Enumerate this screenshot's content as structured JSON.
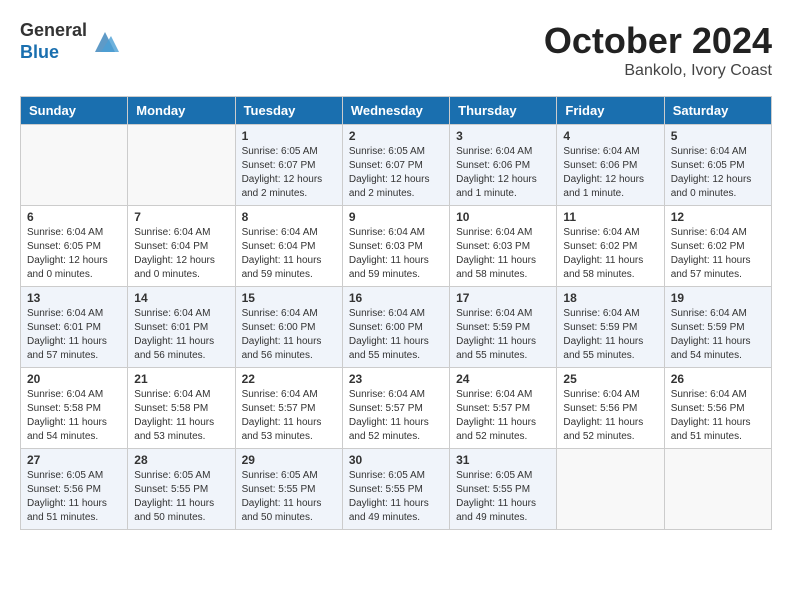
{
  "logo": {
    "general": "General",
    "blue": "Blue"
  },
  "title": "October 2024",
  "subtitle": "Bankolo, Ivory Coast",
  "days": [
    "Sunday",
    "Monday",
    "Tuesday",
    "Wednesday",
    "Thursday",
    "Friday",
    "Saturday"
  ],
  "weeks": [
    {
      "rowClass": "row-odd",
      "cells": [
        {
          "date": "",
          "info": ""
        },
        {
          "date": "",
          "info": ""
        },
        {
          "date": "1",
          "info": "Sunrise: 6:05 AM\nSunset: 6:07 PM\nDaylight: 12 hours\nand 2 minutes."
        },
        {
          "date": "2",
          "info": "Sunrise: 6:05 AM\nSunset: 6:07 PM\nDaylight: 12 hours\nand 2 minutes."
        },
        {
          "date": "3",
          "info": "Sunrise: 6:04 AM\nSunset: 6:06 PM\nDaylight: 12 hours\nand 1 minute."
        },
        {
          "date": "4",
          "info": "Sunrise: 6:04 AM\nSunset: 6:06 PM\nDaylight: 12 hours\nand 1 minute."
        },
        {
          "date": "5",
          "info": "Sunrise: 6:04 AM\nSunset: 6:05 PM\nDaylight: 12 hours\nand 0 minutes."
        }
      ]
    },
    {
      "rowClass": "row-even",
      "cells": [
        {
          "date": "6",
          "info": "Sunrise: 6:04 AM\nSunset: 6:05 PM\nDaylight: 12 hours\nand 0 minutes."
        },
        {
          "date": "7",
          "info": "Sunrise: 6:04 AM\nSunset: 6:04 PM\nDaylight: 12 hours\nand 0 minutes."
        },
        {
          "date": "8",
          "info": "Sunrise: 6:04 AM\nSunset: 6:04 PM\nDaylight: 11 hours\nand 59 minutes."
        },
        {
          "date": "9",
          "info": "Sunrise: 6:04 AM\nSunset: 6:03 PM\nDaylight: 11 hours\nand 59 minutes."
        },
        {
          "date": "10",
          "info": "Sunrise: 6:04 AM\nSunset: 6:03 PM\nDaylight: 11 hours\nand 58 minutes."
        },
        {
          "date": "11",
          "info": "Sunrise: 6:04 AM\nSunset: 6:02 PM\nDaylight: 11 hours\nand 58 minutes."
        },
        {
          "date": "12",
          "info": "Sunrise: 6:04 AM\nSunset: 6:02 PM\nDaylight: 11 hours\nand 57 minutes."
        }
      ]
    },
    {
      "rowClass": "row-odd",
      "cells": [
        {
          "date": "13",
          "info": "Sunrise: 6:04 AM\nSunset: 6:01 PM\nDaylight: 11 hours\nand 57 minutes."
        },
        {
          "date": "14",
          "info": "Sunrise: 6:04 AM\nSunset: 6:01 PM\nDaylight: 11 hours\nand 56 minutes."
        },
        {
          "date": "15",
          "info": "Sunrise: 6:04 AM\nSunset: 6:00 PM\nDaylight: 11 hours\nand 56 minutes."
        },
        {
          "date": "16",
          "info": "Sunrise: 6:04 AM\nSunset: 6:00 PM\nDaylight: 11 hours\nand 55 minutes."
        },
        {
          "date": "17",
          "info": "Sunrise: 6:04 AM\nSunset: 5:59 PM\nDaylight: 11 hours\nand 55 minutes."
        },
        {
          "date": "18",
          "info": "Sunrise: 6:04 AM\nSunset: 5:59 PM\nDaylight: 11 hours\nand 55 minutes."
        },
        {
          "date": "19",
          "info": "Sunrise: 6:04 AM\nSunset: 5:59 PM\nDaylight: 11 hours\nand 54 minutes."
        }
      ]
    },
    {
      "rowClass": "row-even",
      "cells": [
        {
          "date": "20",
          "info": "Sunrise: 6:04 AM\nSunset: 5:58 PM\nDaylight: 11 hours\nand 54 minutes."
        },
        {
          "date": "21",
          "info": "Sunrise: 6:04 AM\nSunset: 5:58 PM\nDaylight: 11 hours\nand 53 minutes."
        },
        {
          "date": "22",
          "info": "Sunrise: 6:04 AM\nSunset: 5:57 PM\nDaylight: 11 hours\nand 53 minutes."
        },
        {
          "date": "23",
          "info": "Sunrise: 6:04 AM\nSunset: 5:57 PM\nDaylight: 11 hours\nand 52 minutes."
        },
        {
          "date": "24",
          "info": "Sunrise: 6:04 AM\nSunset: 5:57 PM\nDaylight: 11 hours\nand 52 minutes."
        },
        {
          "date": "25",
          "info": "Sunrise: 6:04 AM\nSunset: 5:56 PM\nDaylight: 11 hours\nand 52 minutes."
        },
        {
          "date": "26",
          "info": "Sunrise: 6:04 AM\nSunset: 5:56 PM\nDaylight: 11 hours\nand 51 minutes."
        }
      ]
    },
    {
      "rowClass": "row-odd",
      "cells": [
        {
          "date": "27",
          "info": "Sunrise: 6:05 AM\nSunset: 5:56 PM\nDaylight: 11 hours\nand 51 minutes."
        },
        {
          "date": "28",
          "info": "Sunrise: 6:05 AM\nSunset: 5:55 PM\nDaylight: 11 hours\nand 50 minutes."
        },
        {
          "date": "29",
          "info": "Sunrise: 6:05 AM\nSunset: 5:55 PM\nDaylight: 11 hours\nand 50 minutes."
        },
        {
          "date": "30",
          "info": "Sunrise: 6:05 AM\nSunset: 5:55 PM\nDaylight: 11 hours\nand 49 minutes."
        },
        {
          "date": "31",
          "info": "Sunrise: 6:05 AM\nSunset: 5:55 PM\nDaylight: 11 hours\nand 49 minutes."
        },
        {
          "date": "",
          "info": ""
        },
        {
          "date": "",
          "info": ""
        }
      ]
    }
  ]
}
